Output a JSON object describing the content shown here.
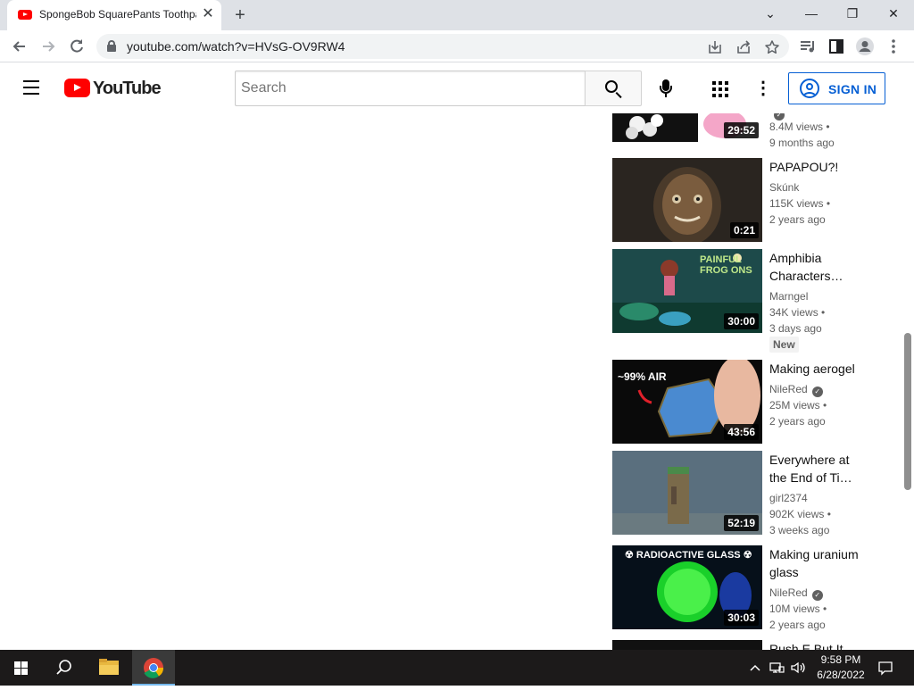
{
  "browser": {
    "tab_title": "SpongeBob SquarePants Toothpaste",
    "tab_close": "✕",
    "new_tab": "+",
    "window_controls": {
      "minimize": "—",
      "maximize": "❐",
      "close": "✕",
      "tab_search": "⌄"
    },
    "url": "youtube.com/watch?v=HVsG-OV9RW4",
    "icons": [
      "back-icon",
      "forward-icon",
      "reload-icon",
      "lock-icon",
      "install-icon",
      "share-icon",
      "bookmark-star-icon",
      "media-icon",
      "side-panel-icon",
      "profile-icon",
      "menu-icon"
    ]
  },
  "youtube": {
    "logo_text": "YouTube",
    "search_placeholder": "Search",
    "sign_in_label": "SIGN IN",
    "more_glyph": "⋮"
  },
  "videos": [
    {
      "title": "",
      "channel": "",
      "views": "8.4M views",
      "age": "9 months ago",
      "duration": "29:52",
      "verified": true
    },
    {
      "title": "PAPAPOU?!",
      "channel": "Skúnk",
      "views": "115K views",
      "age": "2 years ago",
      "duration": "0:21",
      "verified": false
    },
    {
      "title": "Amphibia Characters…",
      "channel": "Marngel",
      "views": "34K views",
      "age": "3 days ago",
      "duration": "30:00",
      "verified": false,
      "badge": "New",
      "thumb_text": "PAINFUL FROG ONS"
    },
    {
      "title": "Making aerogel",
      "channel": "NileRed",
      "views": "25M views",
      "age": "2 years ago",
      "duration": "43:56",
      "verified": true,
      "thumb_text": "~99% AIR"
    },
    {
      "title": "Everywhere at the End of Ti…",
      "channel": "girl2374",
      "views": "902K views",
      "age": "3 weeks ago",
      "duration": "52:19",
      "verified": false
    },
    {
      "title": "Making uranium glass",
      "channel": "NileRed",
      "views": "10M views",
      "age": "2 years ago",
      "duration": "30:03",
      "verified": true,
      "thumb_text": "☢ RADIOACTIVE GLASS ☢"
    },
    {
      "title": "Rush E But It"
    }
  ],
  "taskbar": {
    "time": "9:58 PM",
    "date": "6/28/2022",
    "icons": [
      "windows-start-icon",
      "search-icon",
      "file-explorer-icon",
      "chrome-icon",
      "chevron-up-icon",
      "network-icon",
      "volume-icon",
      "notification-icon"
    ]
  }
}
